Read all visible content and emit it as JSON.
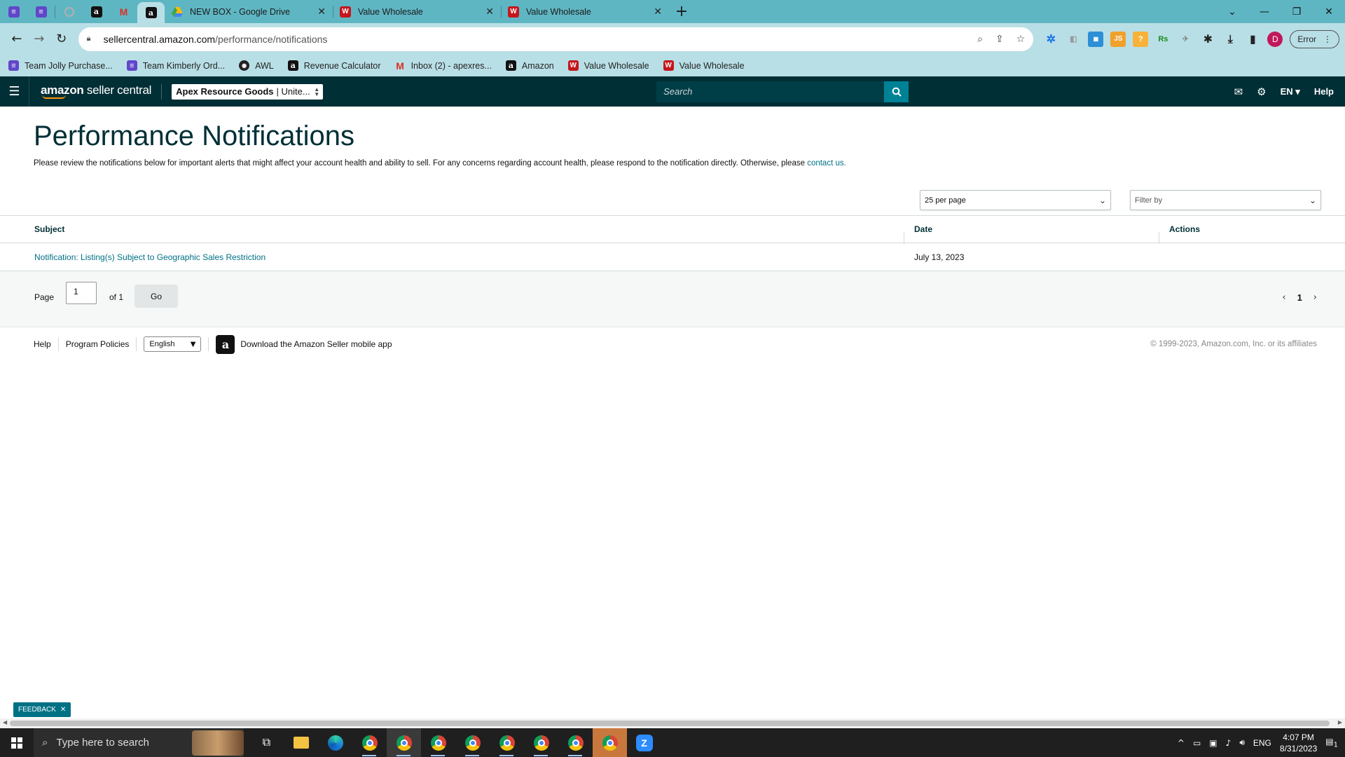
{
  "browser": {
    "tabs": [
      {
        "title": "NEW BOX - Google Drive"
      },
      {
        "title": "Value Wholesale"
      },
      {
        "title": "Value Wholesale"
      }
    ],
    "url_host": "sellercentral.amazon.com",
    "url_path": "/performance/notifications",
    "profile_initial": "D",
    "error_label": "Error",
    "bookmarks": [
      {
        "label": "Team Jolly Purchase...",
        "icon": "sheets-icon"
      },
      {
        "label": "Team Kimberly Ord...",
        "icon": "sheets-icon"
      },
      {
        "label": "AWL",
        "icon": "awl-icon"
      },
      {
        "label": "Revenue Calculator",
        "icon": "amazon-icon"
      },
      {
        "label": "Inbox (2) - apexres...",
        "icon": "gmail-icon"
      },
      {
        "label": "Amazon",
        "icon": "amazon-icon"
      },
      {
        "label": "Value Wholesale",
        "icon": "vw-icon"
      },
      {
        "label": "Value Wholesale",
        "icon": "vw-icon"
      }
    ],
    "extensions": [
      "JS",
      "Rs"
    ]
  },
  "nav": {
    "logo_bold": "amazon",
    "logo_rest": " seller central",
    "store_name_bold": "Apex Resource Goods",
    "store_name_rest": "| Unite...",
    "search_placeholder": "Search",
    "language": "EN",
    "help": "Help"
  },
  "page": {
    "title": "Performance Notifications",
    "intro_text": "Please review the notifications below for important alerts that might affect your account health and ability to sell. For any concerns regarding account health, please respond to the notification directly. Otherwise, please ",
    "intro_link": "contact us.",
    "per_page": "25 per page",
    "filter_placeholder": "Filter by"
  },
  "table": {
    "headers": {
      "subject": "Subject",
      "date": "Date",
      "actions": "Actions"
    },
    "rows": [
      {
        "subject": "Notification: Listing(s) Subject to Geographic Sales Restriction",
        "date": "July 13, 2023",
        "actions": ""
      }
    ]
  },
  "pagination": {
    "page_label": "Page",
    "current_page": "1",
    "of_label": "of 1",
    "go_label": "Go",
    "nav_page": "1"
  },
  "footer": {
    "help": "Help",
    "program_policies": "Program Policies",
    "language": "English",
    "app_download": "Download the Amazon Seller mobile app",
    "copyright": "© 1999-2023, Amazon.com, Inc. or its affiliates"
  },
  "feedback_label": "FEEDBACK",
  "taskbar": {
    "search_placeholder": "Type here to search",
    "input_lang": "ENG",
    "time": "4:07 PM",
    "date": "8/31/2023",
    "notification_count": "1"
  }
}
